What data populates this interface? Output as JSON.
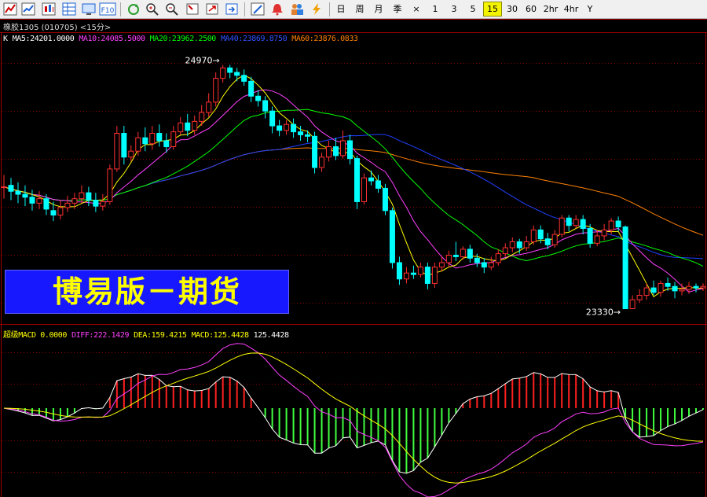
{
  "toolbar": {
    "icons": [
      "line-chart-icon",
      "candlestick-icon",
      "grid-table-icon",
      "monitor-icon",
      "f10-icon",
      "refresh-icon",
      "zoom-in-icon",
      "zoom-out-icon",
      "fullscreen-icon",
      "export-icon",
      "pencil-icon",
      "alarm-bell-icon",
      "people-icon",
      "lightning-icon"
    ],
    "f10_label": "F10",
    "periods": [
      "日",
      "周",
      "月",
      "季",
      "×",
      "1",
      "3",
      "5",
      "15",
      "30",
      "60",
      "2hr",
      "4hr",
      "Y"
    ],
    "active_period": "15"
  },
  "instrument": {
    "title": "橡胶1305 (010705) <15分>"
  },
  "main_legend": {
    "k": "K",
    "ma5": "MA5:24201.0000",
    "ma10": "MA10:24085.5000",
    "ma20": "MA20:23962.2500",
    "ma40": "MA40:23869.8750",
    "ma60": "MA60:23876.0833"
  },
  "macd_legend": {
    "name": "超级MACD 0.0000",
    "diff": "DIFF:222.1429",
    "dea": "DEA:159.4215",
    "macd": "MACD:125.4428",
    "extra": "125.4428"
  },
  "banner": {
    "text": "博易版－期货"
  },
  "colors": {
    "up": "#ff3030",
    "down": "#00ffff",
    "ma5": "#ffff00",
    "ma10": "#ff40ff",
    "ma20": "#00ff00",
    "ma40": "#2040ff",
    "ma60": "#ff8000",
    "grid": "#8c0000",
    "macd_pos": "#ff2020",
    "macd_neg": "#40ff40",
    "diff": "#ffffff",
    "dea": "#ffff00",
    "macd_line2": "#ff40ff"
  },
  "chart_data": [
    {
      "type": "candlestick",
      "title": "",
      "ylim": [
        23280,
        25100
      ],
      "x_count": 100,
      "annotations": [
        {
          "label": "24970",
          "index": 31,
          "value": 24970
        },
        {
          "label": "23330",
          "index": 88,
          "value": 23330
        }
      ],
      "candles": [
        [
          24150,
          24150,
          24230,
          24070
        ],
        [
          24160,
          24120,
          24210,
          24060
        ],
        [
          24120,
          24100,
          24180,
          24040
        ],
        [
          24100,
          24080,
          24160,
          24020
        ],
        [
          24080,
          24040,
          24130,
          23990
        ],
        [
          24040,
          24070,
          24120,
          24000
        ],
        [
          24070,
          24000,
          24100,
          23960
        ],
        [
          23990,
          23960,
          24050,
          23920
        ],
        [
          23960,
          24010,
          24060,
          23930
        ],
        [
          24010,
          24040,
          24090,
          23980
        ],
        [
          24040,
          24070,
          24110,
          24000
        ],
        [
          24070,
          24110,
          24160,
          24040
        ],
        [
          24110,
          24060,
          24150,
          24020
        ],
        [
          24060,
          24020,
          24110,
          23980
        ],
        [
          24020,
          24050,
          24100,
          23990
        ],
        [
          24050,
          24270,
          24300,
          24030
        ],
        [
          24270,
          24510,
          24560,
          24250
        ],
        [
          24510,
          24350,
          24560,
          24300
        ],
        [
          24350,
          24390,
          24430,
          24320
        ],
        [
          24390,
          24480,
          24520,
          24360
        ],
        [
          24480,
          24440,
          24550,
          24390
        ],
        [
          24440,
          24510,
          24560,
          24400
        ],
        [
          24510,
          24460,
          24570,
          24420
        ],
        [
          24460,
          24420,
          24510,
          24380
        ],
        [
          24420,
          24520,
          24560,
          24400
        ],
        [
          24520,
          24580,
          24620,
          24500
        ],
        [
          24580,
          24530,
          24640,
          24490
        ],
        [
          24530,
          24590,
          24630,
          24500
        ],
        [
          24590,
          24650,
          24700,
          24560
        ],
        [
          24650,
          24720,
          24780,
          24620
        ],
        [
          24720,
          24880,
          24920,
          24690
        ],
        [
          24880,
          24950,
          24970,
          24850
        ],
        [
          24950,
          24920,
          24970,
          24880
        ],
        [
          24920,
          24900,
          24950,
          24860
        ],
        [
          24900,
          24860,
          24940,
          24830
        ],
        [
          24860,
          24760,
          24890,
          24720
        ],
        [
          24760,
          24730,
          24800,
          24690
        ],
        [
          24730,
          24660,
          24760,
          24610
        ],
        [
          24660,
          24560,
          24690,
          24510
        ],
        [
          24560,
          24530,
          24600,
          24490
        ],
        [
          24530,
          24570,
          24600,
          24500
        ],
        [
          24570,
          24520,
          24610,
          24480
        ],
        [
          24520,
          24500,
          24560,
          24460
        ],
        [
          24500,
          24490,
          24530,
          24450
        ],
        [
          24490,
          24280,
          24520,
          24240
        ],
        [
          24280,
          24350,
          24380,
          24250
        ],
        [
          24350,
          24420,
          24460,
          24320
        ],
        [
          24420,
          24360,
          24480,
          24330
        ],
        [
          24360,
          24460,
          24530,
          24340
        ],
        [
          24460,
          24340,
          24500,
          24300
        ],
        [
          24340,
          24050,
          24360,
          24000
        ],
        [
          24050,
          24210,
          24240,
          24030
        ],
        [
          24210,
          24190,
          24260,
          24160
        ],
        [
          24190,
          24140,
          24230,
          24110
        ],
        [
          24140,
          23990,
          24170,
          23960
        ],
        [
          23990,
          23640,
          24010,
          23600
        ],
        [
          23640,
          23530,
          23680,
          23490
        ],
        [
          23530,
          23570,
          23610,
          23500
        ],
        [
          23570,
          23560,
          23620,
          23530
        ],
        [
          23560,
          23610,
          23640,
          23540
        ],
        [
          23610,
          23500,
          23640,
          23460
        ],
        [
          23500,
          23610,
          23640,
          23470
        ],
        [
          23610,
          23640,
          23680,
          23580
        ],
        [
          23640,
          23690,
          23720,
          23610
        ],
        [
          23690,
          23680,
          23780,
          23650
        ],
        [
          23680,
          23730,
          23750,
          23660
        ],
        [
          23730,
          23670,
          23760,
          23640
        ],
        [
          23670,
          23640,
          23700,
          23610
        ],
        [
          23640,
          23610,
          23670,
          23570
        ],
        [
          23610,
          23640,
          23680,
          23590
        ],
        [
          23640,
          23700,
          23730,
          23620
        ],
        [
          23700,
          23740,
          23770,
          23680
        ],
        [
          23740,
          23780,
          23810,
          23710
        ],
        [
          23780,
          23740,
          23800,
          23700
        ],
        [
          23740,
          23780,
          23820,
          23720
        ],
        [
          23780,
          23860,
          23890,
          23760
        ],
        [
          23860,
          23800,
          23890,
          23770
        ],
        [
          23800,
          23760,
          23840,
          23730
        ],
        [
          23760,
          23830,
          23860,
          23740
        ],
        [
          23830,
          23940,
          23960,
          23810
        ],
        [
          23940,
          23890,
          23960,
          23850
        ],
        [
          23890,
          23930,
          23960,
          23870
        ],
        [
          23930,
          23870,
          23960,
          23830
        ],
        [
          23870,
          23770,
          23900,
          23740
        ],
        [
          23770,
          23820,
          23860,
          23750
        ],
        [
          23820,
          23860,
          23900,
          23790
        ],
        [
          23860,
          23920,
          23940,
          23830
        ],
        [
          23920,
          23880,
          23950,
          23850
        ],
        [
          23880,
          23330,
          23890,
          23330
        ],
        [
          23330,
          23390,
          23420,
          23330
        ],
        [
          23390,
          23420,
          23460,
          23370
        ],
        [
          23420,
          23470,
          23500,
          23390
        ],
        [
          23470,
          23440,
          23520,
          23420
        ],
        [
          23440,
          23500,
          23520,
          23410
        ],
        [
          23500,
          23480,
          23540,
          23450
        ],
        [
          23480,
          23450,
          23510,
          23400
        ],
        [
          23450,
          23460,
          23500,
          23420
        ],
        [
          23460,
          23480,
          23510,
          23430
        ],
        [
          23480,
          23470,
          23500,
          23440
        ],
        [
          23470,
          23480,
          23500,
          23450
        ]
      ],
      "series": [
        {
          "name": "MA5"
        },
        {
          "name": "MA10"
        },
        {
          "name": "MA20"
        },
        {
          "name": "MA40"
        },
        {
          "name": "MA60"
        }
      ],
      "grid": true
    },
    {
      "type": "bar",
      "title": "",
      "ylim": [
        -300,
        200
      ],
      "series": [
        {
          "name": "MACD"
        },
        {
          "name": "DIFF"
        },
        {
          "name": "DEA"
        }
      ],
      "grid": true
    }
  ]
}
